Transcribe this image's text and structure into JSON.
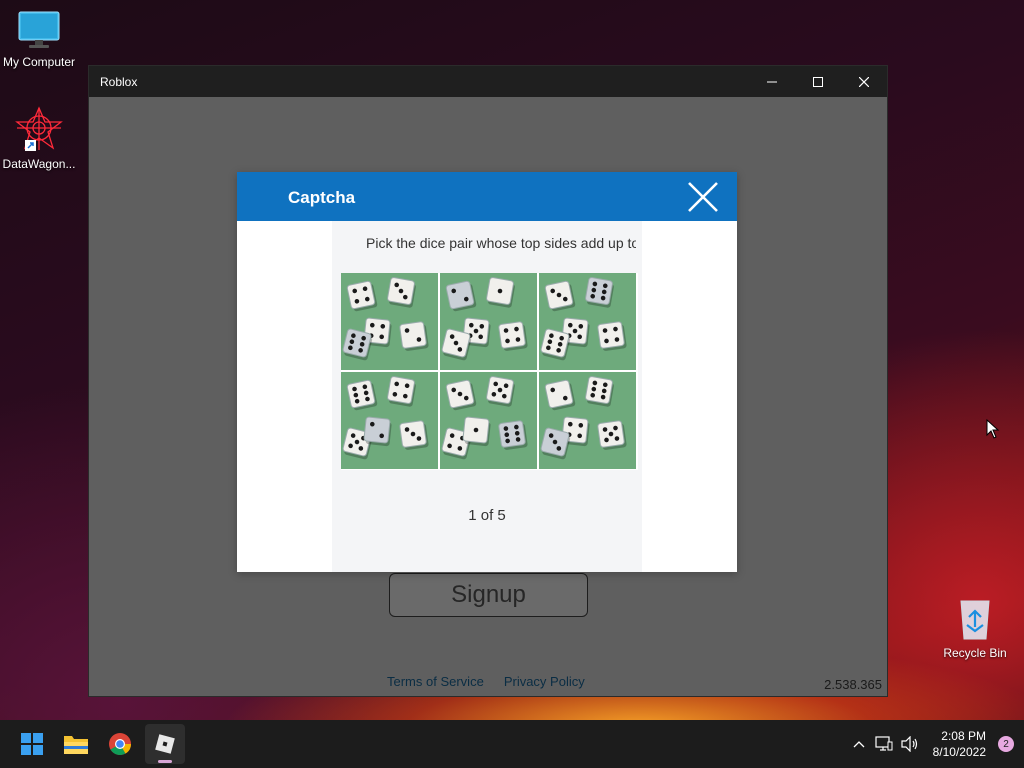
{
  "desktop": {
    "icons": [
      {
        "label": "My Computer",
        "icon": "monitor-icon"
      },
      {
        "label": "DataWagon...",
        "icon": "datawagon-app-icon"
      },
      {
        "label": "Recycle Bin",
        "icon": "recycle-bin-icon"
      }
    ]
  },
  "window": {
    "title": "Roblox",
    "controls": [
      "minimize-icon",
      "maximize-icon",
      "close-icon"
    ]
  },
  "app": {
    "signup_label": "Signup",
    "footer_links": [
      "Terms of Service",
      "Privacy Policy"
    ],
    "version": "2.538.365"
  },
  "captcha": {
    "title": "Captcha",
    "prompt": "Pick the dice pair whose top sides add up to",
    "counter": "1 of 5",
    "tiles": [
      {
        "dice": [
          "4",
          "3",
          "4",
          "2",
          "6"
        ]
      },
      {
        "dice": [
          "1",
          "5",
          "4",
          "3",
          "2"
        ]
      },
      {
        "dice": [
          "5",
          "4",
          "6",
          "3",
          "6"
        ]
      },
      {
        "dice": [
          "3",
          "5",
          "6",
          "4",
          "2"
        ]
      },
      {
        "dice": [
          "4",
          "3",
          "5",
          "1",
          "6"
        ]
      },
      {
        "dice": [
          "2",
          "6",
          "4",
          "5",
          "3"
        ]
      }
    ]
  },
  "taskbar": {
    "apps": [
      "windows-start-icon",
      "file-explorer-icon",
      "chrome-icon",
      "roblox-icon"
    ],
    "time": "2:08 PM",
    "date": "8/10/2022",
    "notification_count": "2"
  },
  "colors": {
    "captcha_header": "#0f72c0",
    "window_body": "#5f5f5f",
    "taskbar": "#1c1c1c"
  }
}
